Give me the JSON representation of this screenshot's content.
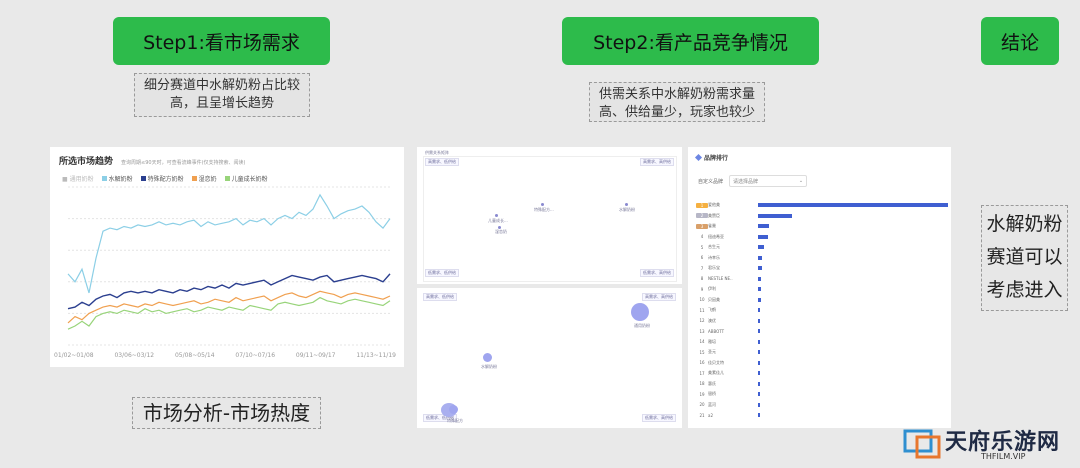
{
  "steps": {
    "step1": "Step1:看市场需求",
    "step2": "Step2:看产品竞争情况",
    "conclusion": "结论"
  },
  "notes": {
    "step1_note_l1": "细分赛道中水解奶粉占比较",
    "step1_note_l2": "高，且呈增长趋势",
    "step2_note_l1": "供需关系中水解奶粉需求量",
    "step2_note_l2": "高、供给量少，玩家也较少",
    "market_caption": "市场分析-市场热度",
    "conclusion_l1": "水解奶粉",
    "conclusion_l2": "赛道可以",
    "conclusion_l3": "考虑进入"
  },
  "trend_panel": {
    "title": "所选市场趋势",
    "subtitle": "查询周期≤90天时，可查看流峰事件(仅支持搜索、阅读)",
    "legend_prefix": "■ 通用奶粉",
    "legend": [
      {
        "name": "水解奶粉",
        "color": "#8ccfe6"
      },
      {
        "name": "特殊配方奶粉",
        "color": "#2b3f8f"
      },
      {
        "name": "湿恋奶",
        "color": "#f0a050"
      },
      {
        "name": "儿童成长奶粉",
        "color": "#98d47a"
      }
    ],
    "x_labels": [
      "01/02~01/08",
      "03/06~03/12",
      "05/08~05/14",
      "07/10~07/16",
      "09/11~09/17",
      "11/13~11/19"
    ]
  },
  "chart_data": {
    "type": "line",
    "x_count": 47,
    "ylim": [
      0,
      100
    ],
    "grid": true,
    "series": [
      {
        "name": "水解奶粉",
        "color": "#8ccfe6",
        "values": [
          45,
          40,
          48,
          33,
          55,
          72,
          74,
          73,
          75,
          74,
          76,
          75,
          76,
          78,
          76,
          77,
          76,
          78,
          79,
          75,
          78,
          76,
          77,
          78,
          80,
          76,
          79,
          78,
          80,
          76,
          80,
          82,
          80,
          84,
          82,
          86,
          95,
          88,
          80,
          83,
          85,
          86,
          88,
          84,
          78,
          74,
          80
        ]
      },
      {
        "name": "特殊配方奶粉",
        "color": "#2b3f8f",
        "values": [
          23,
          24,
          27,
          25,
          29,
          31,
          32,
          30,
          33,
          34,
          33,
          34,
          33,
          35,
          34,
          33,
          35,
          34,
          36,
          35,
          37,
          36,
          38,
          36,
          39,
          38,
          39,
          40,
          41,
          38,
          40,
          42,
          44,
          43,
          42,
          41,
          43,
          44,
          40,
          41,
          42,
          43,
          44,
          43,
          42,
          40,
          45
        ]
      },
      {
        "name": "湿恋奶",
        "color": "#f0a050",
        "values": [
          14,
          18,
          16,
          20,
          22,
          24,
          25,
          24,
          26,
          25,
          24,
          26,
          25,
          27,
          26,
          25,
          26,
          27,
          28,
          26,
          27,
          29,
          28,
          27,
          30,
          28,
          29,
          30,
          31,
          28,
          30,
          32,
          33,
          31,
          30,
          32,
          34,
          33,
          32,
          30,
          32,
          33,
          32,
          31,
          30,
          29,
          31
        ]
      },
      {
        "name": "儿童成长奶粉",
        "color": "#98d47a",
        "values": [
          10,
          12,
          15,
          12,
          18,
          20,
          21,
          20,
          22,
          21,
          20,
          23,
          21,
          22,
          20,
          21,
          22,
          23,
          21,
          22,
          24,
          23,
          22,
          24,
          23,
          22,
          25,
          24,
          23,
          22,
          26,
          27,
          26,
          25,
          26,
          27,
          30,
          28,
          27,
          26,
          28,
          29,
          28,
          27,
          26,
          25,
          28
        ]
      }
    ]
  },
  "supply_panel": {
    "title": "供需关系矩阵",
    "tags": [
      "高需求、低供给",
      "高需求、高供给",
      "低需求、低供给",
      "低需求、高供给"
    ],
    "points": [
      "儿童成长...",
      "特殊配方...",
      "水解奶粉",
      "湿恋奶"
    ]
  },
  "bubble_panel": {
    "tags": [
      "高需求、低供给",
      "高需求、高供给",
      "低需求、低供给",
      "低需求、高供给"
    ],
    "bubbles": [
      "通用奶粉",
      "水解奶粉",
      "特殊配方"
    ]
  },
  "brand_panel": {
    "title": "品牌排行",
    "filter_label": "自定义品牌",
    "filter_value": "请选择品牌",
    "brands": [
      {
        "rank": "1",
        "name": "爱他美",
        "value": 100
      },
      {
        "rank": "2",
        "name": "美赞臣",
        "value": 18
      },
      {
        "rank": "3",
        "name": "雀巢",
        "value": 6
      },
      {
        "rank": "4",
        "name": "纽迪希亚",
        "value": 5
      },
      {
        "rank": "5",
        "name": "合生元",
        "value": 3
      },
      {
        "rank": "6",
        "name": "诗幸乐",
        "value": 2
      },
      {
        "rank": "7",
        "name": "君乐宝",
        "value": 2
      },
      {
        "rank": "8",
        "name": "NESTLE NE..",
        "value": 1.5
      },
      {
        "rank": "9",
        "name": "伊利",
        "value": 1.5
      },
      {
        "rank": "10",
        "name": "贝因美",
        "value": 1.5
      },
      {
        "rank": "11",
        "name": "飞鹤",
        "value": 1.2
      },
      {
        "rank": "12",
        "name": "澳优",
        "value": 1.2
      },
      {
        "rank": "13",
        "name": "ABBOTT",
        "value": 0.3
      },
      {
        "rank": "14",
        "name": "雅培",
        "value": 0.3
      },
      {
        "rank": "15",
        "name": "圣元",
        "value": 0.3
      },
      {
        "rank": "16",
        "name": "佳贝艾特",
        "value": 0.2
      },
      {
        "rank": "17",
        "name": "美素佳儿",
        "value": 0.2
      },
      {
        "rank": "18",
        "name": "惠氏",
        "value": 0.2
      },
      {
        "rank": "19",
        "name": "银桥",
        "value": 0.2
      },
      {
        "rank": "20",
        "name": "蓝河",
        "value": 0.2
      },
      {
        "rank": "21",
        "name": "a2",
        "value": 0.2
      }
    ]
  },
  "watermark": {
    "name": "天府乐游网",
    "url": "THFILM.VIP"
  },
  "colors": {
    "accent_green": "#2dbb4b",
    "bar_blue": "#3f5fd1"
  }
}
